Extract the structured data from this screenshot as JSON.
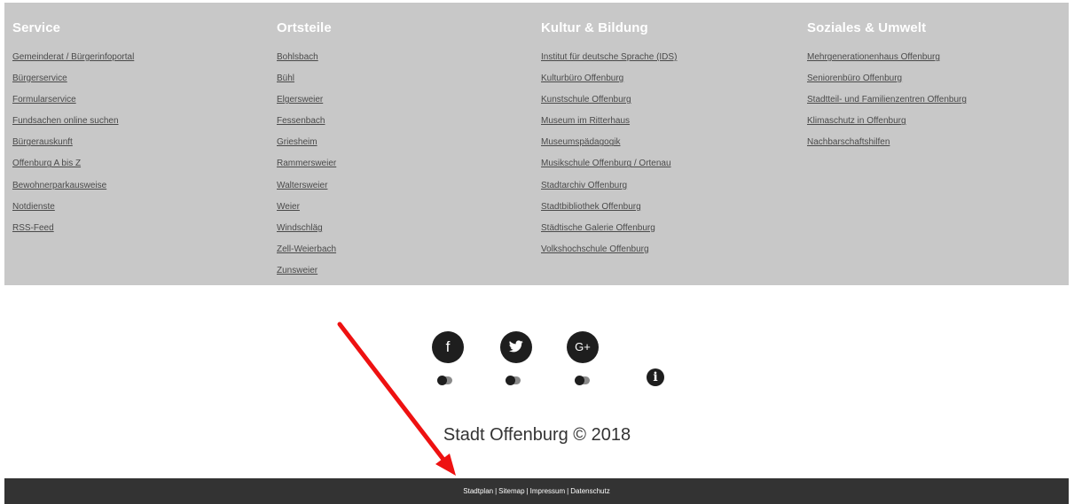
{
  "footer": {
    "columns": [
      {
        "title": "Service",
        "links": [
          "Gemeinderat / Bürgerinfoportal",
          "Bürgerservice",
          "Formularservice",
          "Fundsachen online suchen",
          "Bürgerauskunft",
          "Offenburg A bis Z",
          "Bewohnerparkausweise",
          "Notdienste",
          "RSS-Feed"
        ]
      },
      {
        "title": "Ortsteile",
        "links": [
          "Bohlsbach",
          "Bühl",
          "Elgersweier",
          "Fessenbach",
          "Griesheim",
          "Rammersweier",
          "Waltersweier",
          "Weier",
          "Windschläg",
          "Zell-Weierbach",
          "Zunsweier"
        ]
      },
      {
        "title": "Kultur & Bildung",
        "links": [
          "Institut für deutsche Sprache (IDS)",
          "Kulturbüro Offenburg",
          "Kunstschule Offenburg",
          "Museum im Ritterhaus",
          "Museumspädagogik",
          "Musikschule Offenburg / Ortenau",
          "Stadtarchiv Offenburg",
          "Stadtbibliothek Offenburg",
          "Städtische Galerie Offenburg",
          "Volkshochschule Offenburg"
        ]
      },
      {
        "title": "Soziales & Umwelt",
        "links": [
          "Mehrgenerationenhaus Offenburg",
          "Seniorenbüro Offenburg",
          "Stadtteil- und Familienzentren Offenburg",
          "Klimaschutz in Offenburg",
          "Nachbarschaftshilfen"
        ]
      }
    ]
  },
  "social": {
    "facebook_glyph": "f",
    "twitter_glyph": "🐦",
    "googleplus_glyph": "G+",
    "info_glyph": "i",
    "icons": [
      "facebook-icon",
      "twitter-icon",
      "googleplus-icon",
      "info-icon"
    ]
  },
  "copyright": "Stadt Offenburg © 2018",
  "bottom_bar": {
    "links": [
      "Stadtplan",
      "Sitemap",
      "Impressum",
      "Datenschutz"
    ],
    "separator": "|"
  },
  "colors": {
    "footer_bg": "#c8c8c8",
    "bottom_bar_bg": "#333333",
    "arrow": "#ee1111"
  }
}
